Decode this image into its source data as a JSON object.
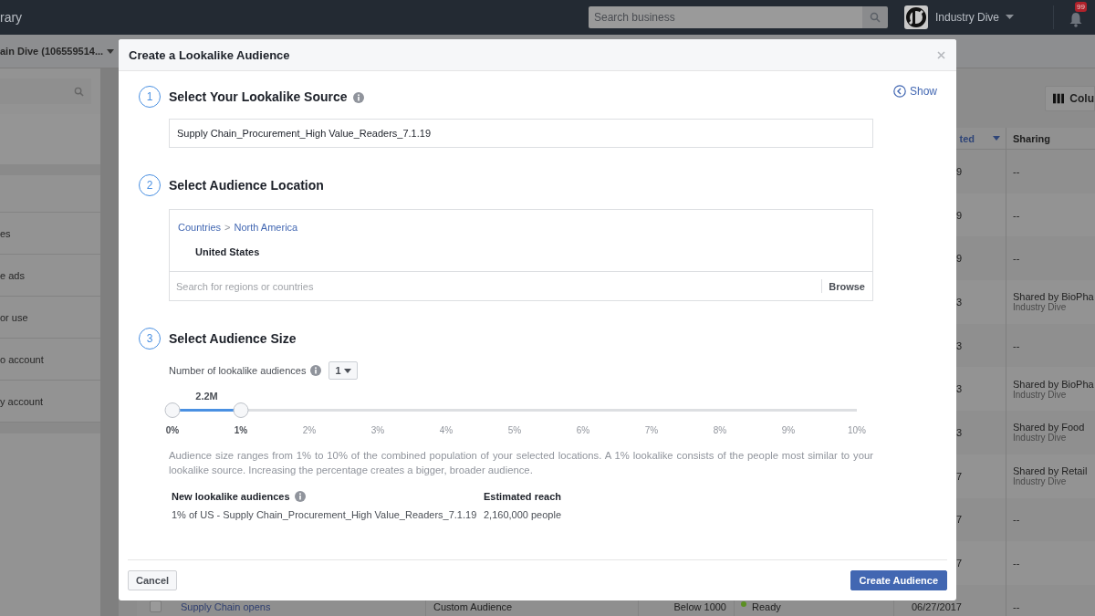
{
  "top_bar": {
    "title": "rary",
    "search": {
      "placeholder": "Search business"
    },
    "account": "Industry Dive",
    "notifications": "99"
  },
  "account_bar": {
    "account": "ain Dive (106559514..."
  },
  "sidebar": {
    "items": [
      {
        "label": "es"
      },
      {
        "label": "e ads"
      },
      {
        "label": "or use"
      },
      {
        "label": "o account"
      },
      {
        "label": "y account"
      }
    ]
  },
  "toolbar": {
    "columns_button": "Colu"
  },
  "table": {
    "columns": [
      {
        "label": "ted",
        "sorted": true
      },
      {
        "label": "Sharing",
        "sorted": false
      }
    ],
    "rows": [
      {
        "date": "9",
        "sharing": "--"
      },
      {
        "date": "9",
        "sharing": "--"
      },
      {
        "date": "9",
        "sharing": "--"
      },
      {
        "date": "3",
        "sharing": "Shared by BioPha",
        "sharing_sub": "Industry Dive"
      },
      {
        "date": "3",
        "sharing": "--"
      },
      {
        "date": "3",
        "sharing": "Shared by BioPha",
        "sharing_sub": "Industry Dive"
      },
      {
        "date": "3",
        "sharing": "Shared by Food",
        "sharing_sub": "Industry Dive"
      },
      {
        "date": "7",
        "sharing": "Shared by Retail",
        "sharing_sub": "Industry Dive"
      },
      {
        "date": "7",
        "sharing": "--"
      },
      {
        "date": "7",
        "sharing": "--"
      },
      {
        "checked": false,
        "name": "Supply Chain opens",
        "type": "Custom Audience",
        "size": "Below 1000",
        "status": "Ready",
        "color": "#5b8f22",
        "date": "06/27/2017",
        "sharing": "--"
      }
    ]
  },
  "dialog": {
    "title": "Create a Lookalike Audience",
    "show_link": "Show",
    "steps": [
      {
        "number": "1",
        "title": "Select Your Lookalike Source",
        "info": true
      },
      {
        "number": "2",
        "title": "Select Audience Location",
        "info": false
      },
      {
        "number": "3",
        "title": "Select Audience Size",
        "info": false
      }
    ],
    "source": {
      "value": "Supply Chain_Procurement_High Value_Readers_7.1.19"
    },
    "location": {
      "breadcrumb": [
        "Countries",
        "North America"
      ],
      "separator": ">",
      "selected": "United States",
      "search": {
        "placeholder": "Search for regions or countries"
      },
      "browse_button": "Browse"
    },
    "count": {
      "label": "Number of lookalike audiences",
      "value": "1"
    },
    "slider": {
      "value_label": "2.2M",
      "level": 0.1,
      "ticks": [
        {
          "label": "0%",
          "in_range": true
        },
        {
          "label": "1%",
          "in_range": true
        },
        {
          "label": "2%",
          "in_range": false
        },
        {
          "label": "3%",
          "in_range": false
        },
        {
          "label": "4%",
          "in_range": false
        },
        {
          "label": "5%",
          "in_range": false
        },
        {
          "label": "6%",
          "in_range": false
        },
        {
          "label": "7%",
          "in_range": false
        },
        {
          "label": "8%",
          "in_range": false
        },
        {
          "label": "9%",
          "in_range": false
        },
        {
          "label": "10%",
          "in_range": false
        }
      ]
    },
    "description": "Audience size ranges from 1% to 10% of the combined population of your selected locations. A 1% lookalike consists of the people most similar to your lookalike source. Increasing the percentage creates a bigger, broader audience.",
    "results": {
      "columns": [
        "New lookalike audiences",
        "Estimated reach"
      ],
      "rows": [
        [
          "1% of US - Supply Chain_Procurement_High Value_Readers_7.1.19",
          "2,160,000 people"
        ]
      ]
    },
    "buttons": [
      {
        "label": "Cancel",
        "kind": "secondary"
      },
      {
        "label": "Create Audience",
        "kind": "primary"
      }
    ]
  }
}
